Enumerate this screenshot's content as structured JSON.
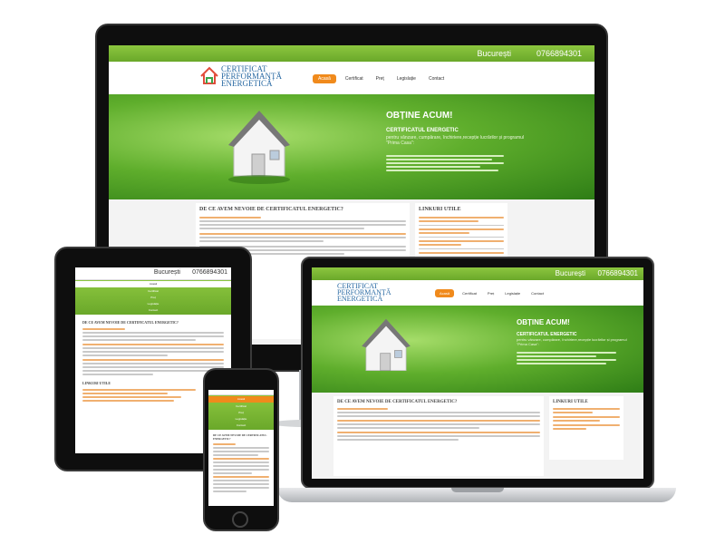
{
  "site": {
    "city": "București",
    "phone": "0766894301",
    "logo_lines": [
      "CERTIFICAT",
      "PERFORMANȚĂ",
      "ENERGETICĂ"
    ],
    "nav": [
      "Acasă",
      "Certificat",
      "Preț",
      "Legislație",
      "Contact"
    ],
    "hero": {
      "title": "OBȚINE ACUM!",
      "subtitle": "CERTIFICATUL ENERGETIC",
      "desc": "pentru vânzare, cumpărare, închiriere,recepție lucrărilor și programul \"Prima Casa\":"
    },
    "section_title": "DE CE AVEM NEVOIE DE CERTIFICATUL ENERGETIC?",
    "sidebar_title": "LINKURI UTILE",
    "tablet_city": "București",
    "tablet_phone": "0766894301"
  },
  "colors": {
    "green": "#6aa82a",
    "orange": "#f08a1c",
    "logo_blue": "#2a6aa3"
  }
}
